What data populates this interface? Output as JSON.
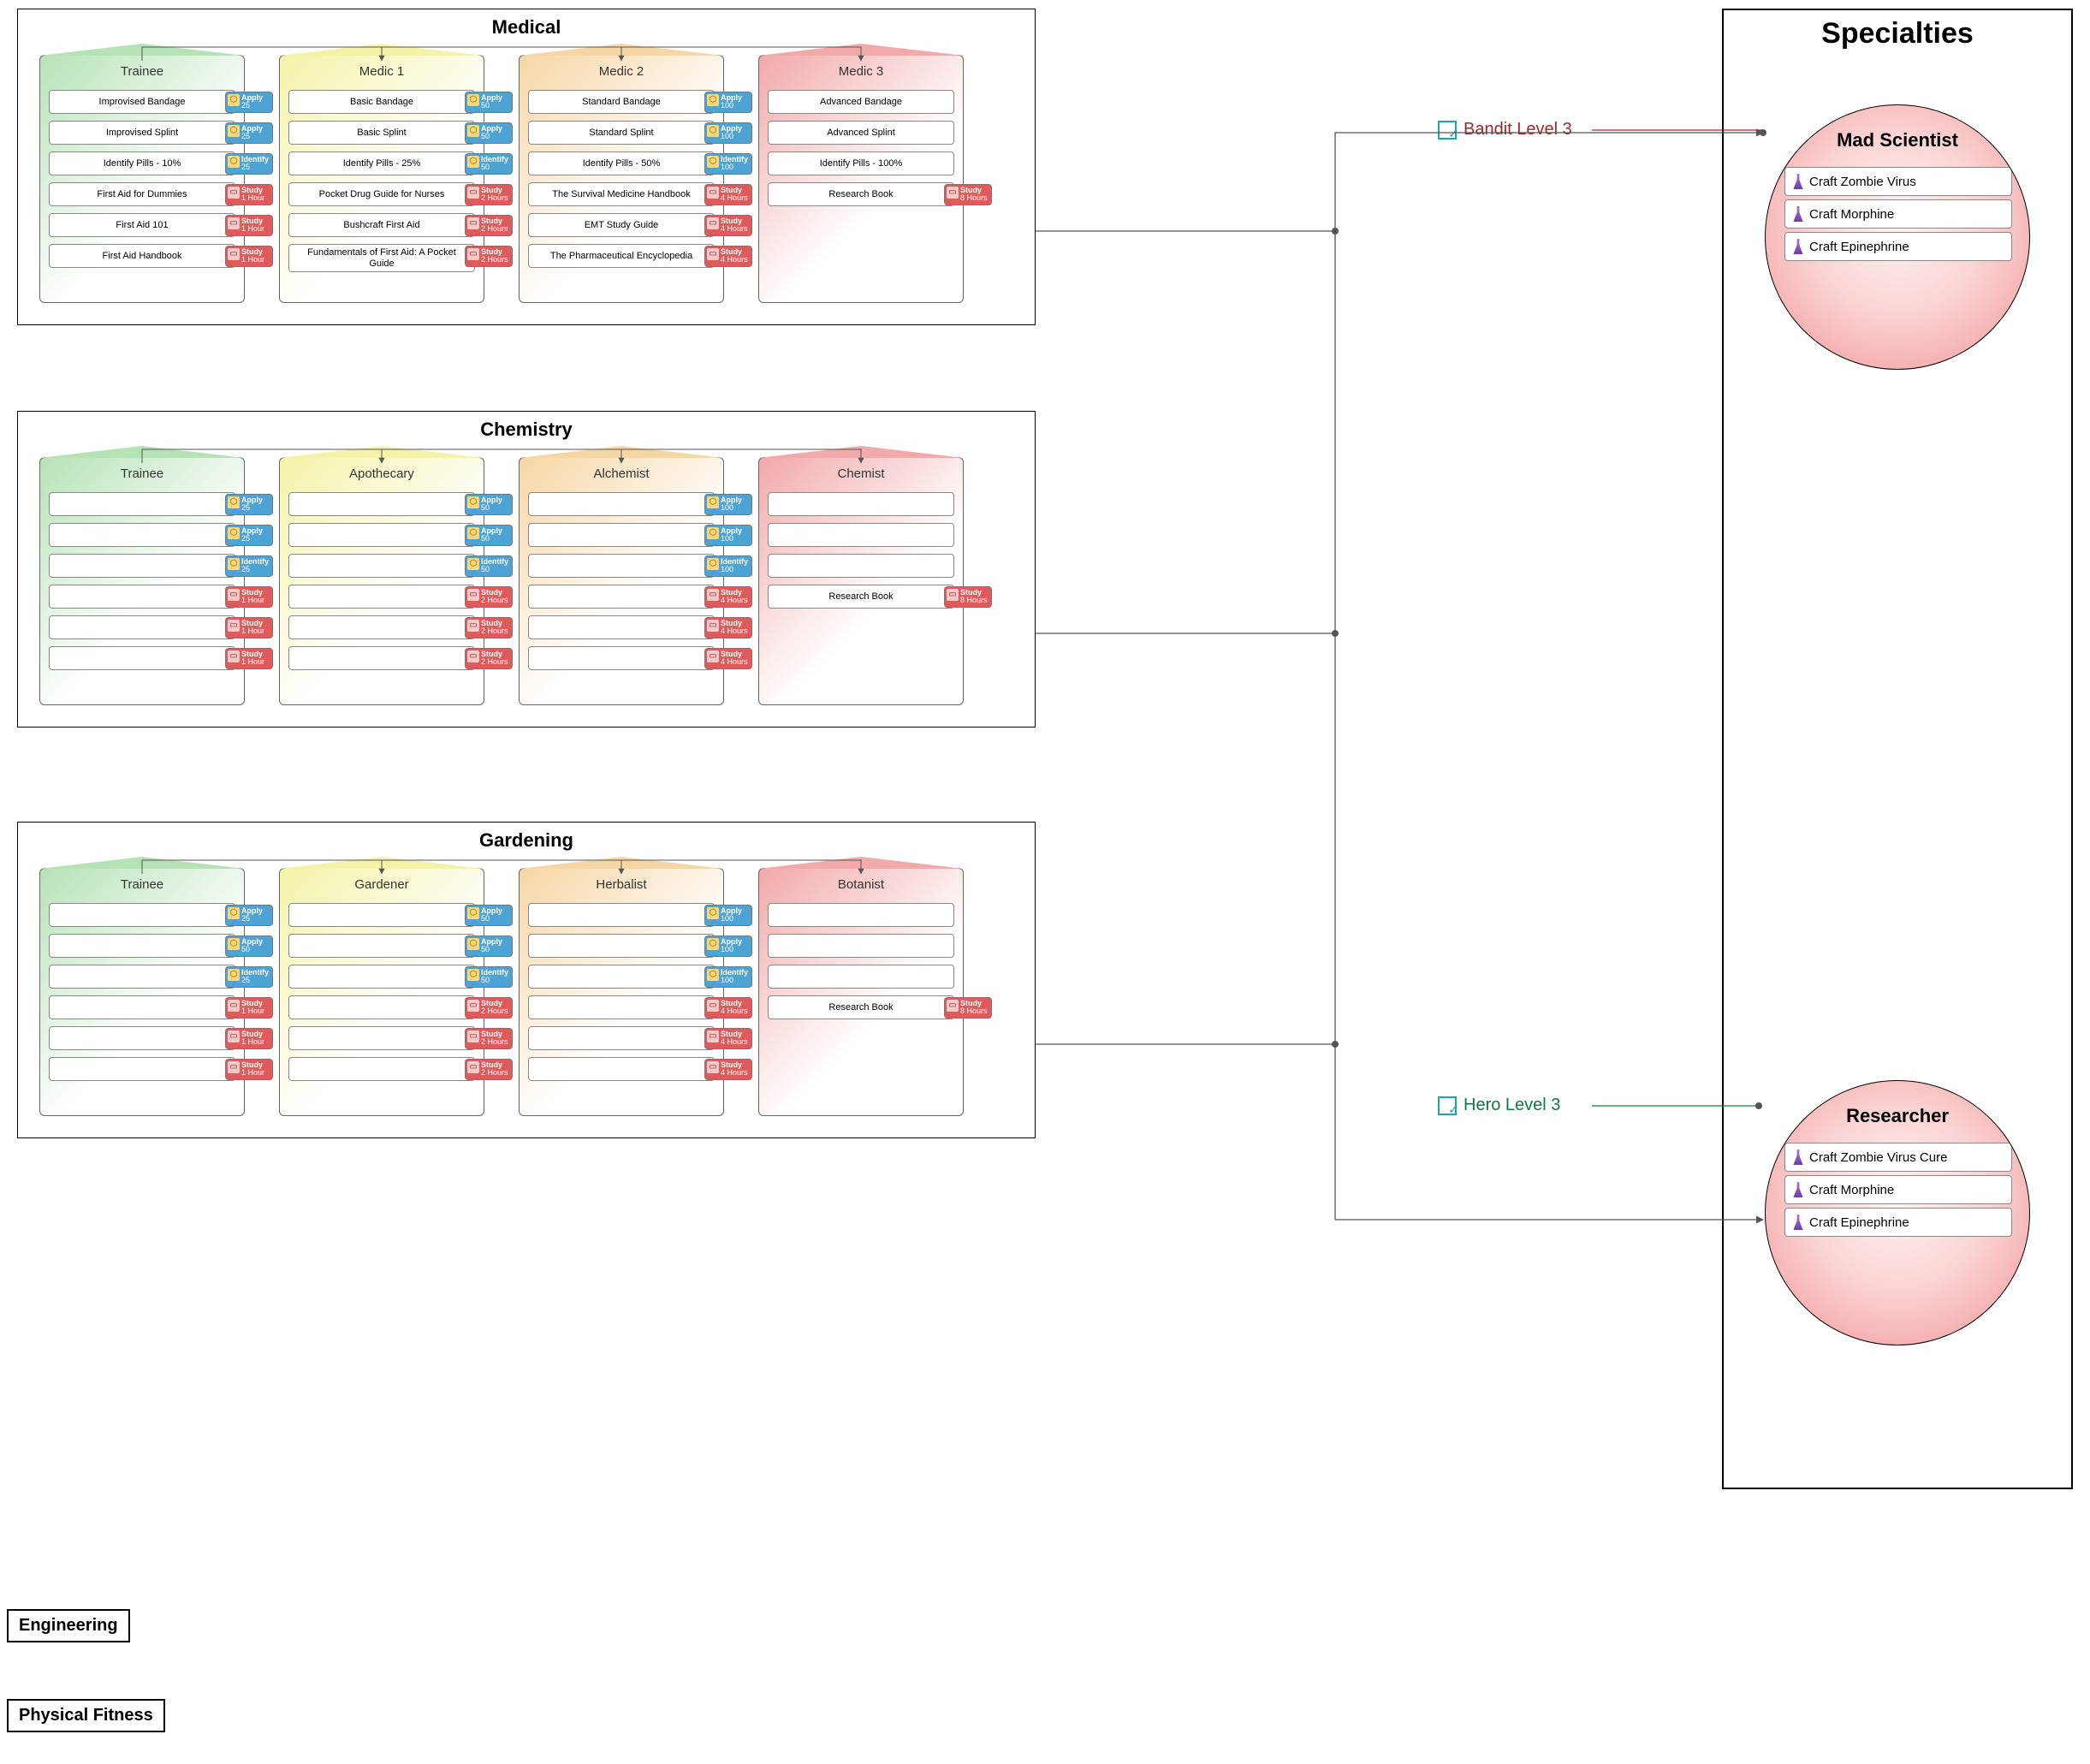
{
  "sections": [
    {
      "name": "Medical",
      "tiers": [
        {
          "name": "Trainee",
          "color": "green",
          "entries": [
            {
              "label": "Improvised Bandage",
              "tag": {
                "type": "apply",
                "l1": "Apply",
                "l2": "25"
              }
            },
            {
              "label": "Improvised Splint",
              "tag": {
                "type": "apply",
                "l1": "Apply",
                "l2": "25"
              }
            },
            {
              "label": "Identify Pills - 10%",
              "tag": {
                "type": "identify",
                "l1": "Identify",
                "l2": "25"
              }
            },
            {
              "label": "First Aid for Dummies",
              "tag": {
                "type": "study",
                "l1": "Study",
                "l2": "1 Hour"
              }
            },
            {
              "label": "First Aid 101",
              "tag": {
                "type": "study",
                "l1": "Study",
                "l2": "1 Hour"
              }
            },
            {
              "label": "First Aid Handbook",
              "tag": {
                "type": "study",
                "l1": "Study",
                "l2": "1 Hour"
              }
            }
          ]
        },
        {
          "name": "Medic 1",
          "color": "yellow",
          "entries": [
            {
              "label": "Basic Bandage",
              "tag": {
                "type": "apply",
                "l1": "Apply",
                "l2": "50"
              }
            },
            {
              "label": "Basic Splint",
              "tag": {
                "type": "apply",
                "l1": "Apply",
                "l2": "50"
              }
            },
            {
              "label": "Identify Pills - 25%",
              "tag": {
                "type": "identify",
                "l1": "Identify",
                "l2": "50"
              }
            },
            {
              "label": "Pocket Drug Guide for Nurses",
              "tag": {
                "type": "study",
                "l1": "Study",
                "l2": "2 Hours"
              }
            },
            {
              "label": "Bushcraft First Aid",
              "tag": {
                "type": "study",
                "l1": "Study",
                "l2": "2 Hours"
              }
            },
            {
              "label": "Fundamentals of First Aid: A Pocket Guide",
              "tag": {
                "type": "study",
                "l1": "Study",
                "l2": "2 Hours"
              }
            }
          ]
        },
        {
          "name": "Medic 2",
          "color": "orange",
          "entries": [
            {
              "label": "Standard Bandage",
              "tag": {
                "type": "apply",
                "l1": "Apply",
                "l2": "100"
              }
            },
            {
              "label": "Standard Splint",
              "tag": {
                "type": "apply",
                "l1": "Apply",
                "l2": "100"
              }
            },
            {
              "label": "Identify Pills - 50%",
              "tag": {
                "type": "identify",
                "l1": "Identify",
                "l2": "100"
              }
            },
            {
              "label": "The Survival Medicine Handbook",
              "tag": {
                "type": "study",
                "l1": "Study",
                "l2": "4 Hours"
              }
            },
            {
              "label": "EMT Study Guide",
              "tag": {
                "type": "study",
                "l1": "Study",
                "l2": "4 Hours"
              }
            },
            {
              "label": "The Pharmaceutical Encyclopedia",
              "tag": {
                "type": "study",
                "l1": "Study",
                "l2": "4 Hours"
              }
            }
          ]
        },
        {
          "name": "Medic 3",
          "color": "red",
          "entries": [
            {
              "label": "Advanced Bandage",
              "tag": null
            },
            {
              "label": "Advanced Splint",
              "tag": null
            },
            {
              "label": "Identify Pills - 100%",
              "tag": null
            },
            {
              "label": "Research Book",
              "tag": {
                "type": "study",
                "l1": "Study",
                "l2": "8 Hours"
              }
            }
          ]
        }
      ]
    },
    {
      "name": "Chemistry",
      "tiers": [
        {
          "name": "Trainee",
          "color": "green",
          "entries": [
            {
              "label": "",
              "tag": {
                "type": "apply",
                "l1": "Apply",
                "l2": "25"
              }
            },
            {
              "label": "",
              "tag": {
                "type": "apply",
                "l1": "Apply",
                "l2": "25"
              }
            },
            {
              "label": "",
              "tag": {
                "type": "identify",
                "l1": "Identify",
                "l2": "25"
              }
            },
            {
              "label": "",
              "tag": {
                "type": "study",
                "l1": "Study",
                "l2": "1 Hour"
              }
            },
            {
              "label": "",
              "tag": {
                "type": "study",
                "l1": "Study",
                "l2": "1 Hour"
              }
            },
            {
              "label": "",
              "tag": {
                "type": "study",
                "l1": "Study",
                "l2": "1 Hour"
              }
            }
          ]
        },
        {
          "name": "Apothecary",
          "color": "yellow",
          "entries": [
            {
              "label": "",
              "tag": {
                "type": "apply",
                "l1": "Apply",
                "l2": "50"
              }
            },
            {
              "label": "",
              "tag": {
                "type": "apply",
                "l1": "Apply",
                "l2": "50"
              }
            },
            {
              "label": "",
              "tag": {
                "type": "identify",
                "l1": "Identify",
                "l2": "50"
              }
            },
            {
              "label": "",
              "tag": {
                "type": "study",
                "l1": "Study",
                "l2": "2 Hours"
              }
            },
            {
              "label": "",
              "tag": {
                "type": "study",
                "l1": "Study",
                "l2": "2 Hours"
              }
            },
            {
              "label": "",
              "tag": {
                "type": "study",
                "l1": "Study",
                "l2": "2 Hours"
              }
            }
          ]
        },
        {
          "name": "Alchemist",
          "color": "orange",
          "entries": [
            {
              "label": "",
              "tag": {
                "type": "apply",
                "l1": "Apply",
                "l2": "100"
              }
            },
            {
              "label": "",
              "tag": {
                "type": "apply",
                "l1": "Apply",
                "l2": "100"
              }
            },
            {
              "label": "",
              "tag": {
                "type": "identify",
                "l1": "Identify",
                "l2": "100"
              }
            },
            {
              "label": "",
              "tag": {
                "type": "study",
                "l1": "Study",
                "l2": "4 Hours"
              }
            },
            {
              "label": "",
              "tag": {
                "type": "study",
                "l1": "Study",
                "l2": "4 Hours"
              }
            },
            {
              "label": "",
              "tag": {
                "type": "study",
                "l1": "Study",
                "l2": "4 Hours"
              }
            }
          ]
        },
        {
          "name": "Chemist",
          "color": "red",
          "entries": [
            {
              "label": "",
              "tag": null
            },
            {
              "label": "",
              "tag": null
            },
            {
              "label": "",
              "tag": null
            },
            {
              "label": "Research Book",
              "tag": {
                "type": "study",
                "l1": "Study",
                "l2": "8 Hours"
              }
            }
          ]
        }
      ]
    },
    {
      "name": "Gardening",
      "tiers": [
        {
          "name": "Trainee",
          "color": "green",
          "entries": [
            {
              "label": "",
              "tag": {
                "type": "apply",
                "l1": "Apply",
                "l2": "25"
              }
            },
            {
              "label": "",
              "tag": {
                "type": "apply",
                "l1": "Apply",
                "l2": "50"
              }
            },
            {
              "label": "",
              "tag": {
                "type": "identify",
                "l1": "Identify",
                "l2": "25"
              }
            },
            {
              "label": "",
              "tag": {
                "type": "study",
                "l1": "Study",
                "l2": "1 Hour"
              }
            },
            {
              "label": "",
              "tag": {
                "type": "study",
                "l1": "Study",
                "l2": "1 Hour"
              }
            },
            {
              "label": "",
              "tag": {
                "type": "study",
                "l1": "Study",
                "l2": "1 Hour"
              }
            }
          ]
        },
        {
          "name": "Gardener",
          "color": "yellow",
          "entries": [
            {
              "label": "",
              "tag": {
                "type": "apply",
                "l1": "Apply",
                "l2": "50"
              }
            },
            {
              "label": "",
              "tag": {
                "type": "apply",
                "l1": "Apply",
                "l2": "50"
              }
            },
            {
              "label": "",
              "tag": {
                "type": "identify",
                "l1": "Identify",
                "l2": "50"
              }
            },
            {
              "label": "",
              "tag": {
                "type": "study",
                "l1": "Study",
                "l2": "2 Hours"
              }
            },
            {
              "label": "",
              "tag": {
                "type": "study",
                "l1": "Study",
                "l2": "2 Hours"
              }
            },
            {
              "label": "",
              "tag": {
                "type": "study",
                "l1": "Study",
                "l2": "2 Hours"
              }
            }
          ]
        },
        {
          "name": "Herbalist",
          "color": "orange",
          "entries": [
            {
              "label": "",
              "tag": {
                "type": "apply",
                "l1": "Apply",
                "l2": "100"
              }
            },
            {
              "label": "",
              "tag": {
                "type": "apply",
                "l1": "Apply",
                "l2": "100"
              }
            },
            {
              "label": "",
              "tag": {
                "type": "identify",
                "l1": "Identify",
                "l2": "100"
              }
            },
            {
              "label": "",
              "tag": {
                "type": "study",
                "l1": "Study",
                "l2": "4 Hours"
              }
            },
            {
              "label": "",
              "tag": {
                "type": "study",
                "l1": "Study",
                "l2": "4 Hours"
              }
            },
            {
              "label": "",
              "tag": {
                "type": "study",
                "l1": "Study",
                "l2": "4 Hours"
              }
            }
          ]
        },
        {
          "name": "Botanist",
          "color": "red",
          "entries": [
            {
              "label": "",
              "tag": null
            },
            {
              "label": "",
              "tag": null
            },
            {
              "label": "",
              "tag": null
            },
            {
              "label": "Research Book",
              "tag": {
                "type": "study",
                "l1": "Study",
                "l2": "8 Hours"
              }
            }
          ]
        }
      ]
    }
  ],
  "specialties": {
    "title": "Specialties",
    "list": [
      {
        "name": "Mad Scientist",
        "req": "Bandit Level 3",
        "req_kind": "bandit",
        "crafts": [
          "Craft Zombie Virus",
          "Craft Morphine",
          "Craft Epinephrine"
        ]
      },
      {
        "name": "Researcher",
        "req": "Hero Level 3",
        "req_kind": "hero",
        "crafts": [
          "Craft Zombie Virus Cure",
          "Craft Morphine",
          "Craft Epinephrine"
        ]
      }
    ]
  },
  "stubs": [
    "Engineering",
    "Physical Fitness"
  ]
}
